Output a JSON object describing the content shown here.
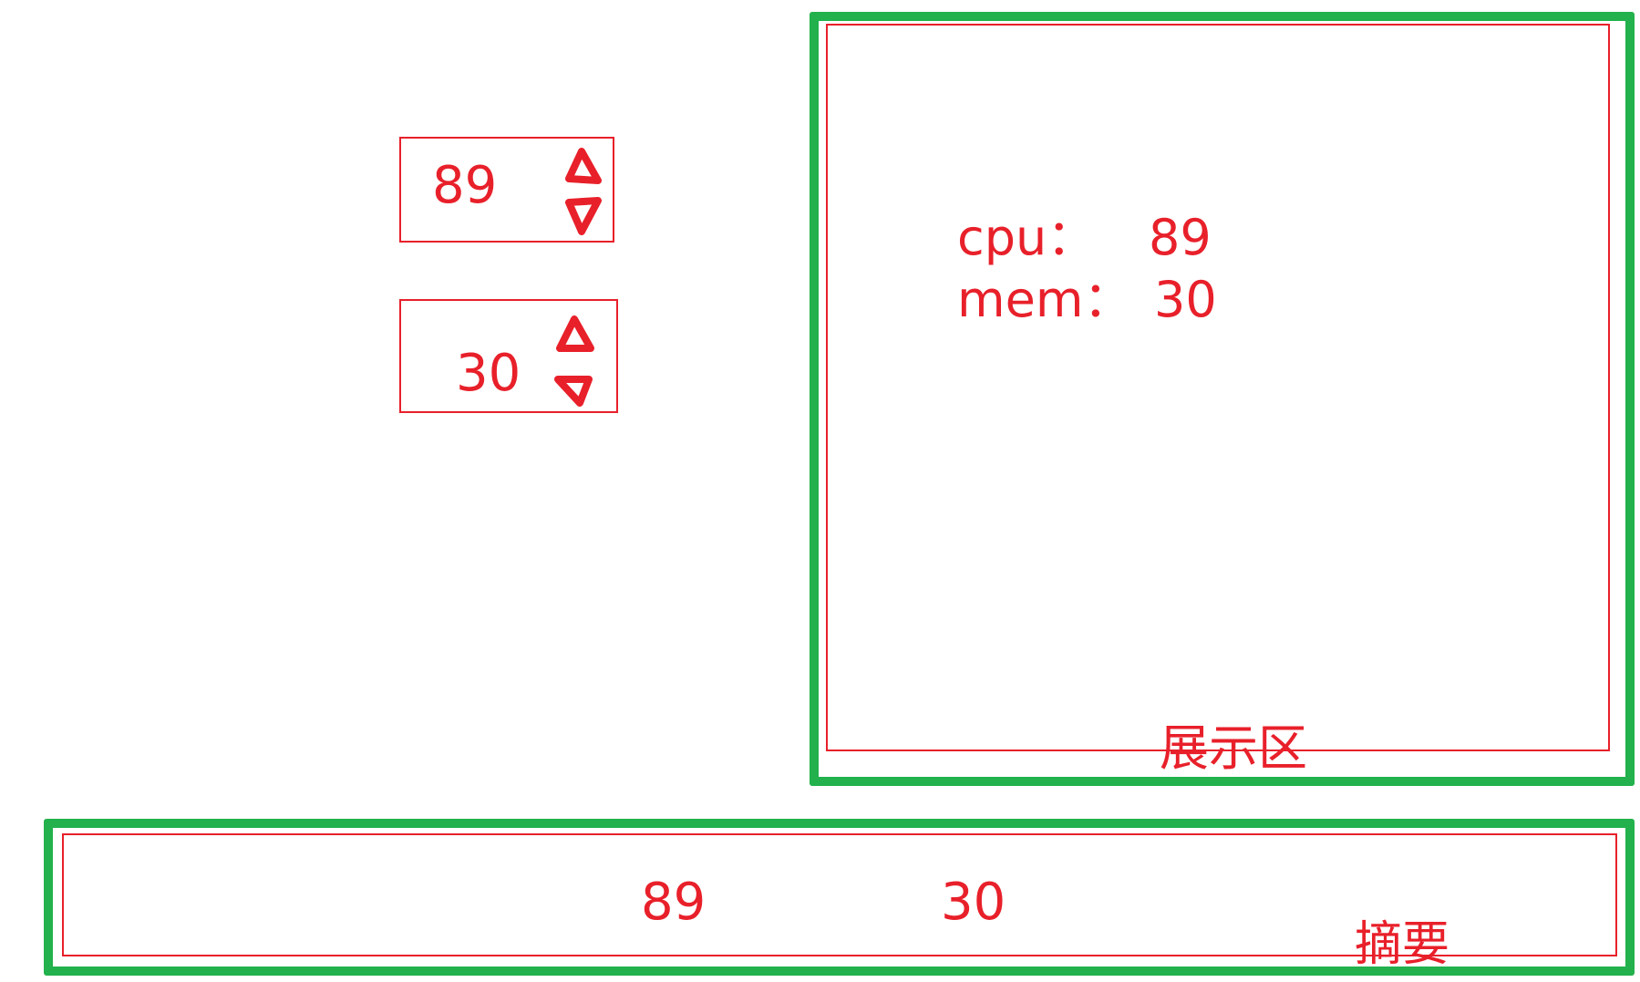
{
  "controls": {
    "cpu_spinbox": {
      "value": "89"
    },
    "mem_spinbox": {
      "value": "30"
    }
  },
  "display_area": {
    "cpu_label": "cpu：",
    "cpu_value": "89",
    "mem_label": "mem：",
    "mem_value": "30",
    "caption": "展示区"
  },
  "summary_area": {
    "cpu_value": "89",
    "mem_value": "30",
    "caption": "摘要"
  },
  "icons": {
    "up": "triangle-up-icon",
    "down": "triangle-down-icon"
  },
  "colors": {
    "annotation_red": "#e8202a",
    "region_green": "#22b14c",
    "background": "#ffffff"
  }
}
